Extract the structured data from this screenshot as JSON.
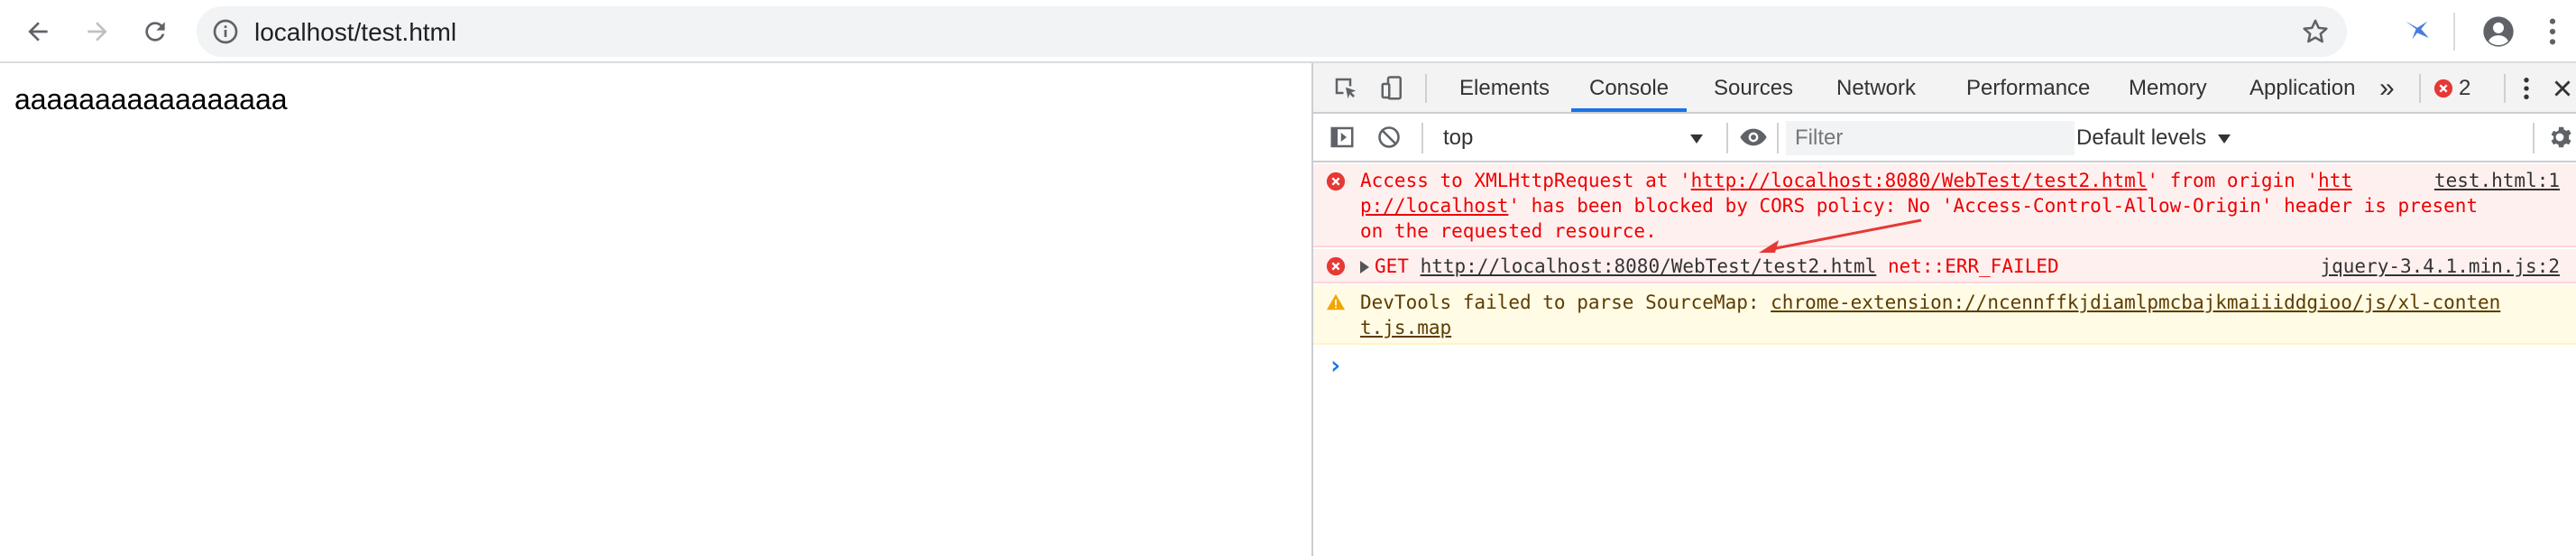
{
  "browser": {
    "url": "localhost/test.html",
    "icons": [
      "back-arrow-icon",
      "forward-arrow-icon",
      "reload-icon",
      "info-icon",
      "star-icon",
      "extension-icon",
      "profile-avatar-icon",
      "kebab-menu-icon"
    ]
  },
  "page": {
    "text": "aaaaaaaaaaaaaaaaa"
  },
  "devtools": {
    "tabs": [
      {
        "label": "Elements"
      },
      {
        "label": "Console"
      },
      {
        "label": "Sources"
      },
      {
        "label": "Network"
      },
      {
        "label": "Performance"
      },
      {
        "label": "Memory"
      },
      {
        "label": "Application"
      }
    ],
    "active_tab": "Console",
    "more_tabs": "»",
    "error_count": "2",
    "console": {
      "context": "top",
      "filter_placeholder": "Filter",
      "levels": "Default levels"
    },
    "messages": [
      {
        "type": "error",
        "line1_a": "Access to XMLHttpRequest at '",
        "line1_url": "http://localhost:8080/WebTest/test2.html",
        "line1_b": "' from origin '",
        "line1_c": "htt",
        "line2_a": "p://localhost",
        "line2_b": "' has been blocked by CORS policy: No 'Access-Control-Allow-Origin' header is present",
        "line3": "on the requested resource.",
        "source": "test.html:1"
      },
      {
        "type": "error",
        "method": "GET",
        "url": "http://localhost:8080/WebTest/test2.html",
        "status": "net::ERR_FAILED",
        "source": "jquery-3.4.1.min.js:2"
      },
      {
        "type": "warning",
        "text_a": "DevTools failed to parse SourceMap: ",
        "url_1": "chrome-extension://ncennffkjdiamlpmcbajkmaiiiddgioo/js/xl-conten",
        "url_2": "t.js.map"
      }
    ],
    "prompt": "›"
  },
  "colors": {
    "active_tab": "#1a73e8",
    "error_text": "#e00000",
    "error_bg": "#fff0f0",
    "warn_bg": "#fffbe5",
    "annotation_arrow": "#e53935"
  }
}
